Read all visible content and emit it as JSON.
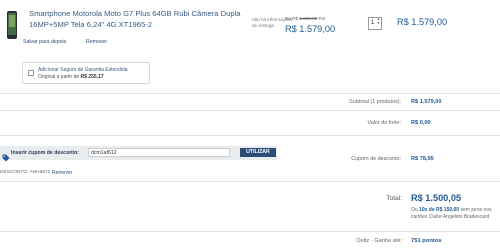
{
  "product": {
    "name": "Smartphone Motorola Moto G7 Plus 64GB Rubi Câmera Dupla 16MP+5MP Tela 6,24\" 4G XT1965-2",
    "save_link": "Salvar para depois",
    "remove_link": "Remover",
    "delivery_info": "não há informações de entrega",
    "from_prefix": "De R$",
    "old_price": "1.899,00",
    "from_suffix": "Por",
    "price": "R$ 1.579,00",
    "quantity": "1",
    "row_total": "R$ 1.579,00"
  },
  "warranty": {
    "line1": "Adicionar Seguro de Garantia Estendida",
    "line2_prefix": "Original a partir de",
    "line2_value": "R$ 255,17"
  },
  "summary": {
    "subtotal_label": "Subtotal (1 produtos):",
    "subtotal_value": "R$ 1.579,00",
    "shipping_label": "Valor do frete:",
    "shipping_value": "R$ 0,00",
    "coupon_discount_label": "Cupom de desconto:",
    "coupon_discount_value": "R$ 78,95",
    "total_label": "Total:",
    "total_value": "R$ 1.500,05",
    "installment_prefix": "Ou",
    "installment_value": "10x de R$ 150,00",
    "installment_suffix": "sem juros nos cartões Clube Angeloni Bradescard",
    "points_label": "Ooltz - Ganhe até:",
    "points_value": "751 pontos"
  },
  "coupon": {
    "label": "Inserir cupom de desconto:",
    "input_value": "dcm1af612",
    "button": "UTILIZAR",
    "applied_label": "DESCONTO: ANH5872",
    "remove": "Remover"
  },
  "colors": {
    "accent": "#1d5a96",
    "button": "#2b4d78",
    "coupon_bar": "#e9ecef"
  }
}
